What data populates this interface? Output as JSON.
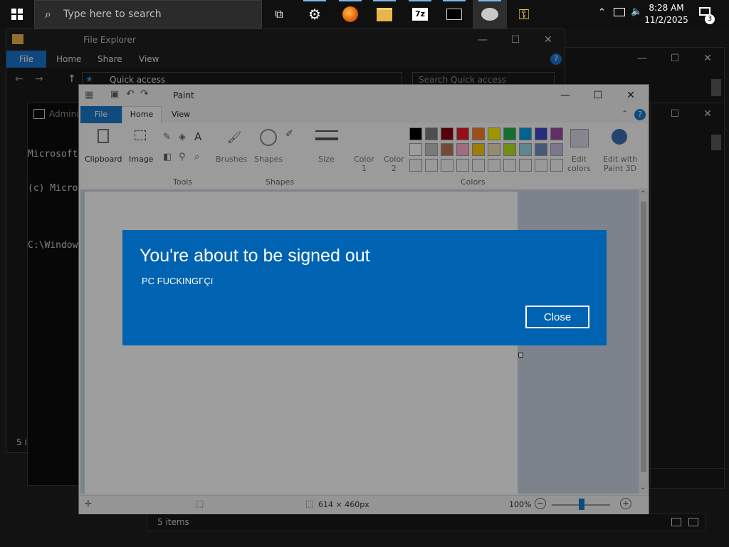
{
  "taskbar": {
    "search_placeholder": "Type here to search",
    "time": "8:28 AM",
    "date": "11/2/2025",
    "notification_count": "3"
  },
  "explorer": {
    "title": "File Explorer",
    "tabs": [
      "File",
      "Home",
      "Share",
      "View"
    ],
    "address": "Quick access",
    "search_placeholder": "Search Quick access",
    "status_left": "5 it",
    "status": "5 items"
  },
  "console": {
    "title": "Admini",
    "lines": [
      "Microsoft",
      "(c) Micros",
      "",
      "C:\\Windows"
    ]
  },
  "paint": {
    "title": "Paint",
    "tabs": [
      "File",
      "Home",
      "View"
    ],
    "groups": {
      "clipboard": "Clipboard",
      "image": "Image",
      "tools": "Tools",
      "brushes": "Brushes",
      "shapes": "Shapes",
      "shapes_group": "Shapes",
      "size": "Size",
      "color1": "Color\n1",
      "color2": "Color\n2",
      "colors": "Colors",
      "edit_colors": "Edit\ncolors",
      "edit_paint3d": "Edit with\nPaint 3D"
    },
    "palette_row1": [
      "#000000",
      "#7f7f7f",
      "#880015",
      "#ed1c24",
      "#ff7f27",
      "#fff200",
      "#22b14c",
      "#00a2e8",
      "#3f48cc",
      "#a349a4"
    ],
    "palette_row2": [
      "#ffffff",
      "#c3c3c3",
      "#b97a57",
      "#ffaec9",
      "#ffc90e",
      "#efe4b0",
      "#b5e61d",
      "#99d9ea",
      "#7092be",
      "#c8bfe7"
    ],
    "canvas_size": "614 × 460px",
    "zoom": "100%"
  },
  "dialog": {
    "title": "You're about to be signed out",
    "message": "PC FUCKINGΓÇï",
    "close_label": "Close"
  }
}
